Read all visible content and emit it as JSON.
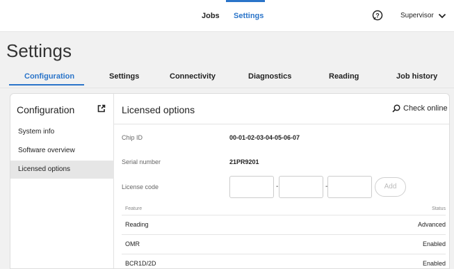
{
  "topbar": {
    "nav": [
      "Jobs",
      "Settings"
    ],
    "user": "Supervisor",
    "help_icon": "help-icon",
    "chevron_icon": "chevron-down-icon"
  },
  "page": {
    "title": "Settings",
    "tabs": [
      "Configuration",
      "Settings",
      "Connectivity",
      "Diagnostics",
      "Reading",
      "Job history"
    ],
    "active_tab": "Configuration"
  },
  "sidebar": {
    "title": "Configuration",
    "items": [
      "System info",
      "Software overview",
      "Licensed options"
    ],
    "active_item": "Licensed options"
  },
  "content": {
    "title": "Licensed options",
    "check_online": "Check online",
    "fields": {
      "chip_id_label": "Chip ID",
      "chip_id_value": "00-01-02-03-04-05-06-07",
      "serial_label": "Serial number",
      "serial_value": "21PR9201",
      "license_label": "License code",
      "license_sep": "-",
      "add_label": "Add"
    },
    "table": {
      "headers": [
        "Feature",
        "Status"
      ],
      "rows": [
        {
          "feature": "Reading",
          "status": "Advanced"
        },
        {
          "feature": "OMR",
          "status": "Enabled"
        },
        {
          "feature": "BCR1D/2D",
          "status": "Enabled"
        }
      ]
    }
  },
  "colors": {
    "accent": "#2a74c9",
    "background": "#f1f1f1"
  }
}
